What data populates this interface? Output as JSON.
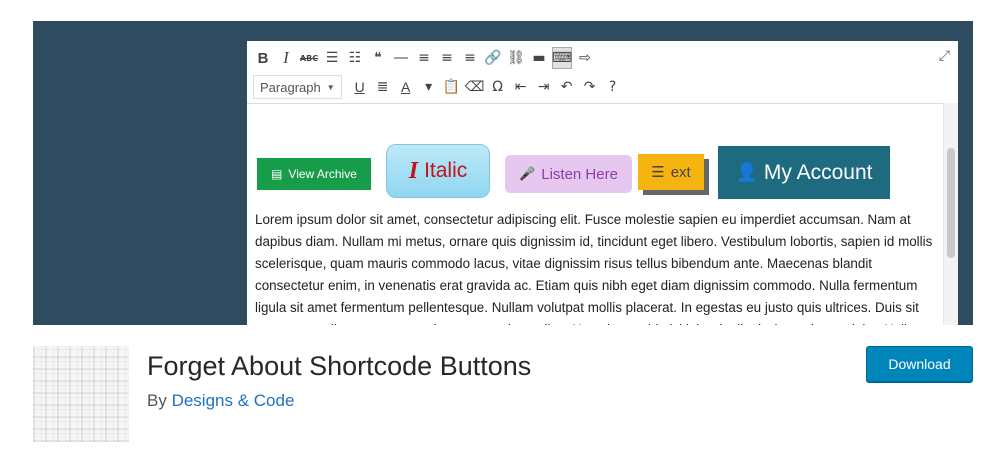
{
  "editor": {
    "toolbar_row1": [
      {
        "name": "bold-button",
        "glyph": "B",
        "cls": "b"
      },
      {
        "name": "italic-button",
        "glyph": "I",
        "cls": "i"
      },
      {
        "name": "strikethrough-button",
        "glyph": "ABC",
        "cls": "abc"
      },
      {
        "name": "bullet-list-button",
        "glyph": "☰",
        "cls": ""
      },
      {
        "name": "numbered-list-button",
        "glyph": "☷",
        "cls": ""
      },
      {
        "name": "blockquote-button",
        "glyph": "❝",
        "cls": ""
      },
      {
        "name": "horizontal-line-button",
        "glyph": "―",
        "cls": ""
      },
      {
        "name": "align-left-button",
        "glyph": "≡",
        "cls": ""
      },
      {
        "name": "align-center-button",
        "glyph": "≡",
        "cls": ""
      },
      {
        "name": "align-right-button",
        "glyph": "≡",
        "cls": ""
      },
      {
        "name": "insert-link-button",
        "glyph": "🔗",
        "cls": "faded"
      },
      {
        "name": "remove-link-button",
        "glyph": "⛓",
        "cls": ""
      },
      {
        "name": "read-more-button",
        "glyph": "▬",
        "cls": ""
      },
      {
        "name": "toolbar-toggle-button",
        "glyph": "⌨",
        "cls": "active"
      },
      {
        "name": "shortcode-button",
        "glyph": "⇨",
        "cls": ""
      }
    ],
    "paragraph_select": "Paragraph",
    "toolbar_row2": [
      {
        "name": "underline-button",
        "glyph": "U",
        "cls": "u"
      },
      {
        "name": "justify-button",
        "glyph": "≣",
        "cls": ""
      },
      {
        "name": "text-color-button",
        "glyph": "A",
        "cls": "u"
      },
      {
        "name": "text-color-dropdown",
        "glyph": "▾",
        "cls": ""
      },
      {
        "name": "paste-text-button",
        "glyph": "📋",
        "cls": ""
      },
      {
        "name": "clear-formatting-button",
        "glyph": "⌫",
        "cls": ""
      },
      {
        "name": "special-character-button",
        "glyph": "Ω",
        "cls": ""
      },
      {
        "name": "outdent-button",
        "glyph": "⇤",
        "cls": ""
      },
      {
        "name": "indent-button",
        "glyph": "⇥",
        "cls": ""
      },
      {
        "name": "undo-button",
        "glyph": "↶",
        "cls": ""
      },
      {
        "name": "redo-button",
        "glyph": "↷",
        "cls": ""
      },
      {
        "name": "help-button",
        "glyph": "?",
        "cls": ""
      }
    ],
    "fullscreen_glyph": "⤢",
    "buttons": {
      "archive_icon": "▤",
      "archive_label": "View Archive",
      "italic_icon": "I",
      "italic_label": "Italic",
      "listen_icon": "🎤",
      "listen_label": "Listen Here",
      "ext_icon": "☰",
      "ext_label": "ext",
      "account_icon": "👤",
      "account_label": "My Account"
    },
    "body_text": " Lorem ipsum dolor sit amet, consectetur adipiscing elit. Fusce molestie sapien eu imperdiet accumsan. Nam at dapibus diam. Nullam mi metus, ornare quis dignissim id, tincidunt eget libero. Vestibulum lobortis, sapien id mollis scelerisque, quam mauris commodo lacus, vitae dignissim risus tellus bibendum ante. Maecenas blandit consectetur enim, in venenatis erat gravida ac. Etiam quis nibh eget diam dignissim commodo. Nulla fermentum ligula sit amet fermentum pellentesque. Nullam volutpat mollis placerat. In egestas eu justo quis ultrices. Duis sit amet tortor aliquet, semper enim eget, pretium tellus. Nunc in erat id nisi lobortis dignissim sed eget dolor. Nullam luctus ante vestibulum, lacinia posuere velit."
  },
  "plugin": {
    "title": "Forget About Shortcode Buttons",
    "by_prefix": "By ",
    "author": "Designs & Code",
    "download_label": "Download"
  },
  "colors": {
    "banner_bg": "#2f4b5f",
    "download_bg": "#0085ba",
    "author_link": "#1e73be"
  }
}
